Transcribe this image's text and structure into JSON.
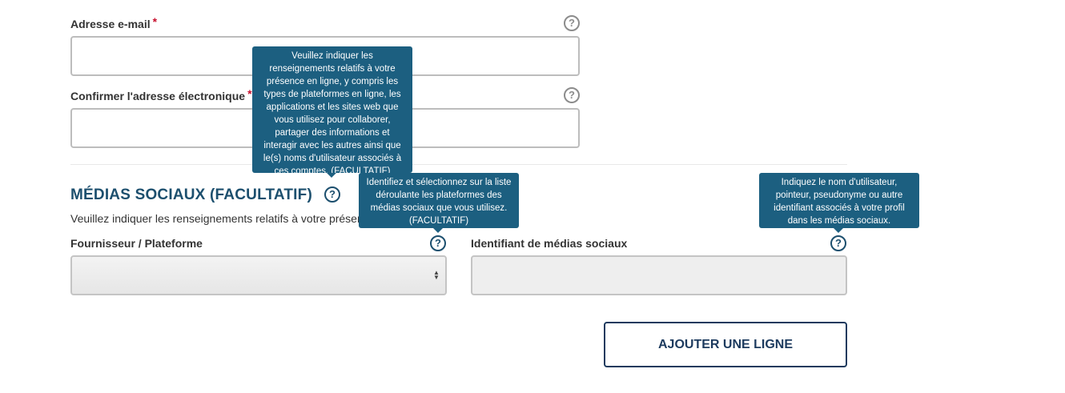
{
  "email": {
    "label": "Adresse e-mail",
    "required_mark": "*",
    "value": ""
  },
  "confirm_email": {
    "label": "Confirmer l'adresse électronique",
    "required_mark": "*",
    "value": ""
  },
  "social": {
    "title": "MÉDIAS SOCIAUX (FACULTATIF)",
    "description": "Veuillez indiquer les renseignements relatifs à votre présence en",
    "provider_label": "Fournisseur / Plateforme",
    "provider_value": "",
    "identifier_label": "Identifiant de médias sociaux",
    "identifier_value": "",
    "add_row_button": "AJOUTER UNE LIGNE"
  },
  "help_glyph": "?",
  "tooltips": {
    "section": "Veuillez indiquer les renseignements relatifs à votre présence en ligne, y compris les types de plateformes en ligne, les applications et les sites web que vous utilisez pour collaborer, partager des informations et interagir avec les autres ainsi que le(s) noms d'utilisateur associés à ces comptes. (FACULTATIF)",
    "provider": "Identifiez et sélectionnez sur la liste déroulante les plateformes des médias sociaux que vous utilisez. (FACULTATIF)",
    "identifier": "Indiquez le nom d'utilisateur, pointeur, pseudonyme ou autre identifiant associés à votre profil dans les médias sociaux."
  },
  "colors": {
    "accent": "#1c4f6e",
    "tooltip_bg": "#1c5f80",
    "required": "#c8102e",
    "button_border": "#1c3a5e"
  },
  "icons": {
    "help": "question-circle-icon",
    "select": "up-down-arrows-icon"
  }
}
